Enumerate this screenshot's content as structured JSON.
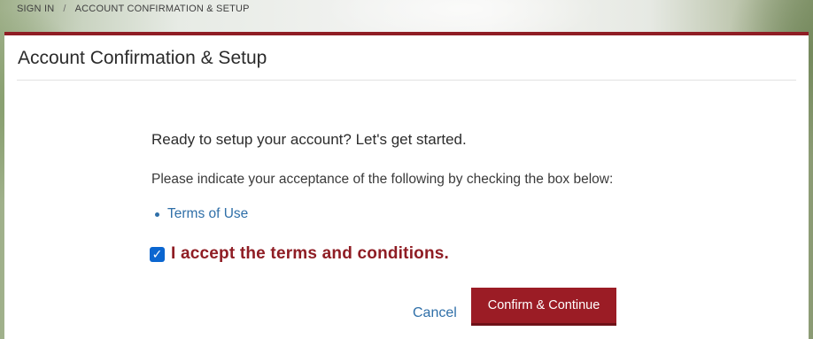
{
  "breadcrumb": {
    "items": [
      "SIGN IN",
      "ACCOUNT CONFIRMATION & SETUP"
    ],
    "separator": "/"
  },
  "page": {
    "title": "Account Confirmation & Setup"
  },
  "content": {
    "lead": "Ready to setup your account? Let's get started.",
    "instruction": "Please indicate your acceptance of the following by checking the box below:",
    "terms_links": [
      {
        "label": "Terms of Use"
      }
    ],
    "accept_checkbox": {
      "checked": true,
      "label": "I accept the terms and conditions."
    }
  },
  "actions": {
    "cancel_label": "Cancel",
    "confirm_label": "Confirm & Continue"
  },
  "colors": {
    "brand": "#8f1d24",
    "button": "#9b1c25",
    "link": "#2f6fa8",
    "checkbox": "#0b66d0"
  },
  "icons": {
    "checkbox": "check-icon",
    "bullet": "bullet-icon"
  }
}
